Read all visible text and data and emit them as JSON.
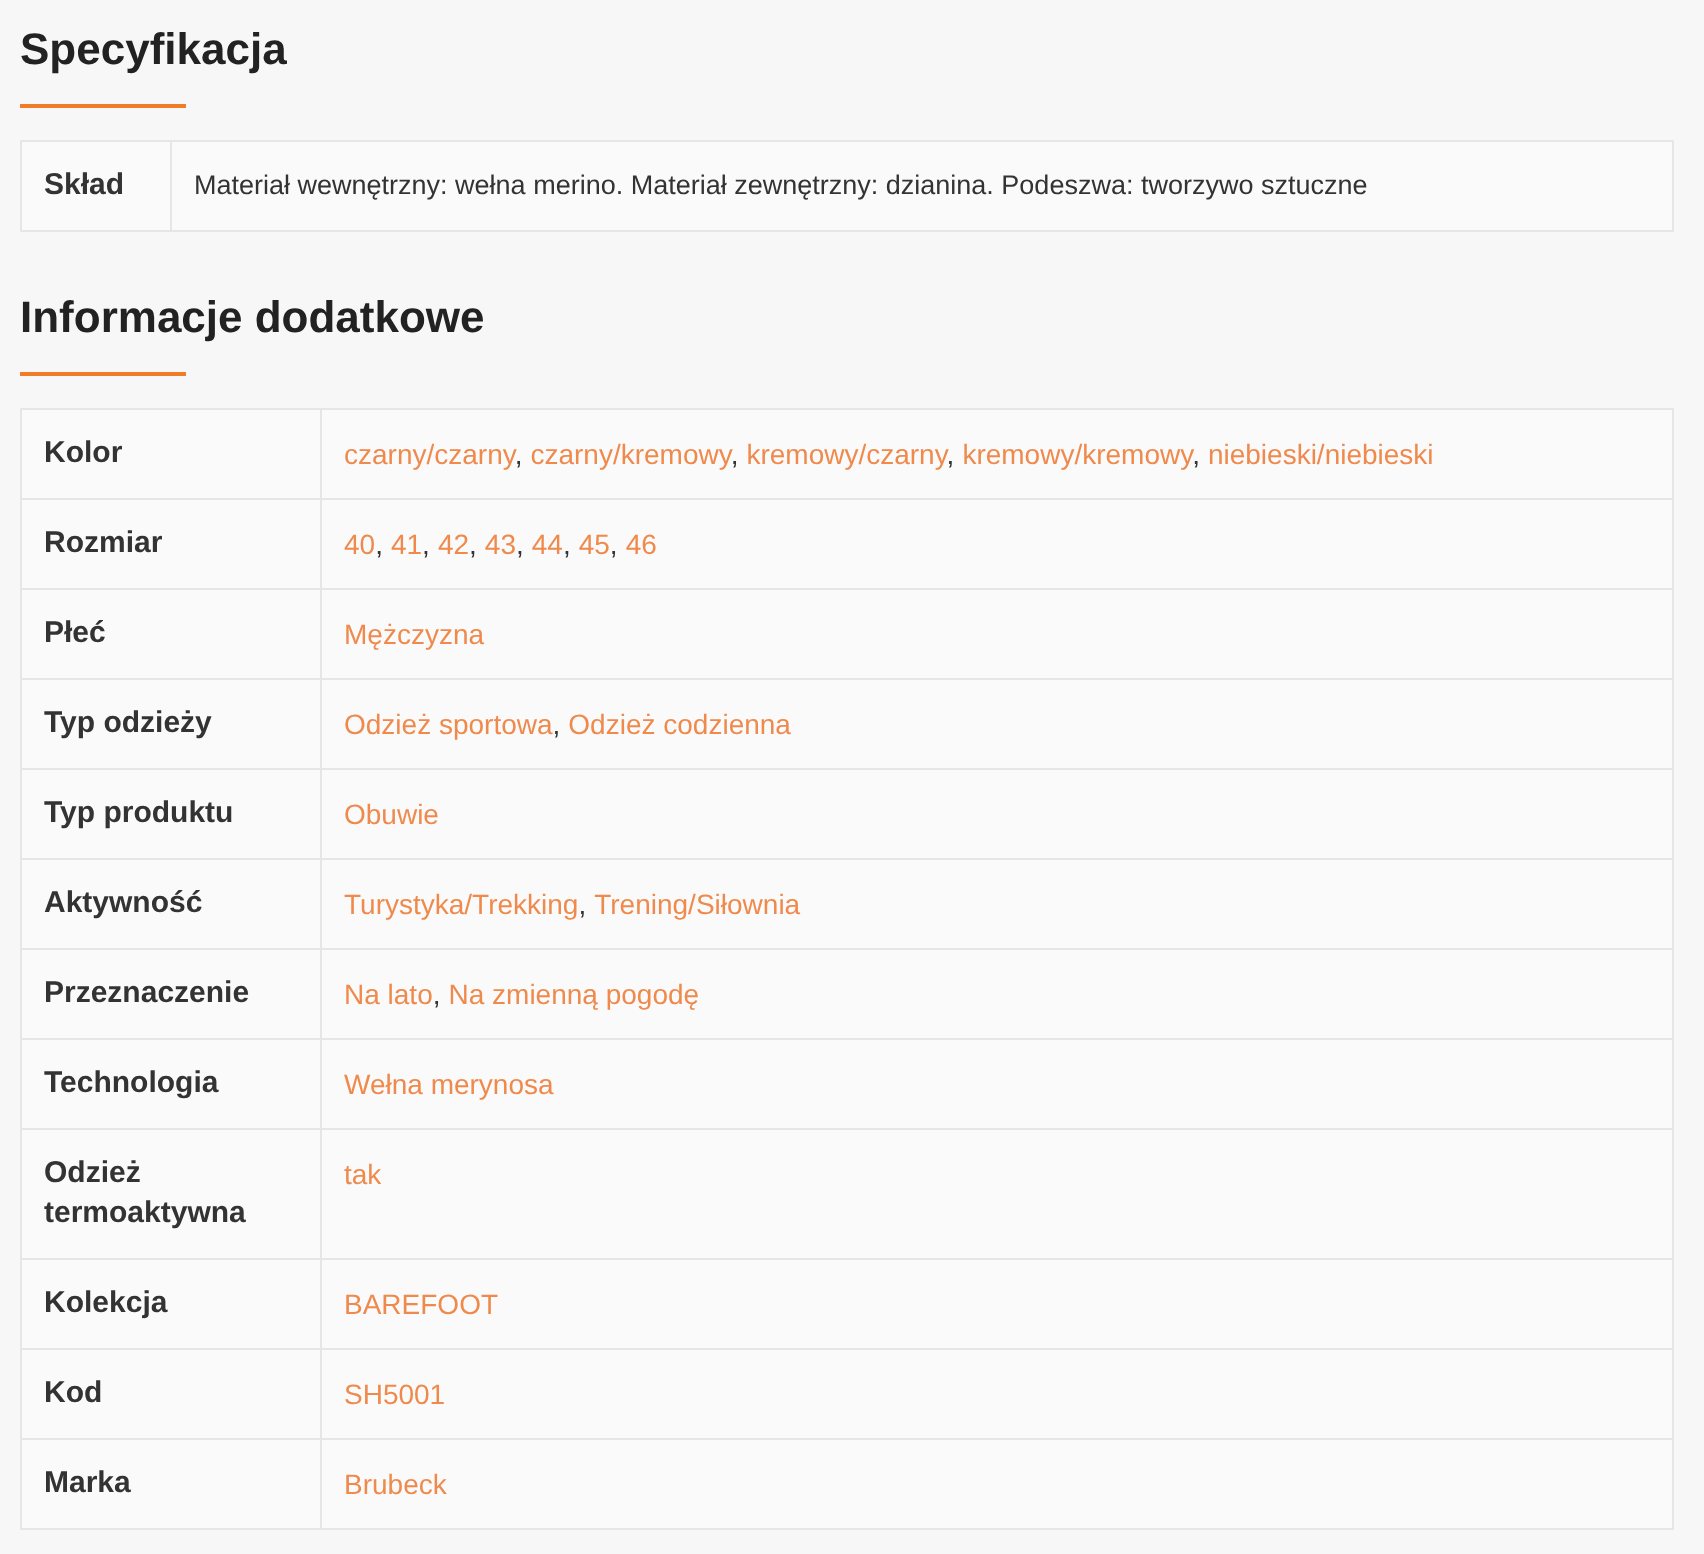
{
  "sections": [
    {
      "title": "Specyfikacja",
      "kind": "text",
      "rows": [
        {
          "label": "Skład",
          "values": [
            "Materiał wewnętrzny: wełna merino. Materiał zewnętrzny: dzianina. Podeszwa: tworzywo sztuczne"
          ]
        }
      ]
    },
    {
      "title": "Informacje dodatkowe",
      "kind": "links",
      "separator": ",",
      "rows": [
        {
          "label": "Kolor",
          "values": [
            "czarny/czarny",
            "czarny/kremowy",
            "kremowy/czarny",
            "kremowy/kremowy",
            "niebieski/niebieski"
          ]
        },
        {
          "label": "Rozmiar",
          "values": [
            "40",
            "41",
            "42",
            "43",
            "44",
            "45",
            "46"
          ]
        },
        {
          "label": "Płeć",
          "values": [
            "Mężczyzna"
          ]
        },
        {
          "label": "Typ odzieży",
          "values": [
            "Odzież sportowa",
            "Odzież codzienna"
          ]
        },
        {
          "label": "Typ produktu",
          "values": [
            "Obuwie"
          ]
        },
        {
          "label": "Aktywność",
          "values": [
            "Turystyka/Trekking",
            "Trening/Siłownia"
          ]
        },
        {
          "label": "Przeznaczenie",
          "values": [
            "Na lato",
            "Na zmienną pogodę"
          ]
        },
        {
          "label": "Technologia",
          "values": [
            "Wełna merynosa"
          ]
        },
        {
          "label": "Odzież termoaktywna",
          "values": [
            "tak"
          ]
        },
        {
          "label": "Kolekcja",
          "values": [
            "BAREFOOT"
          ]
        },
        {
          "label": "Kod",
          "values": [
            "SH5001"
          ]
        },
        {
          "label": "Marka",
          "values": [
            "Brubeck"
          ]
        }
      ]
    }
  ]
}
